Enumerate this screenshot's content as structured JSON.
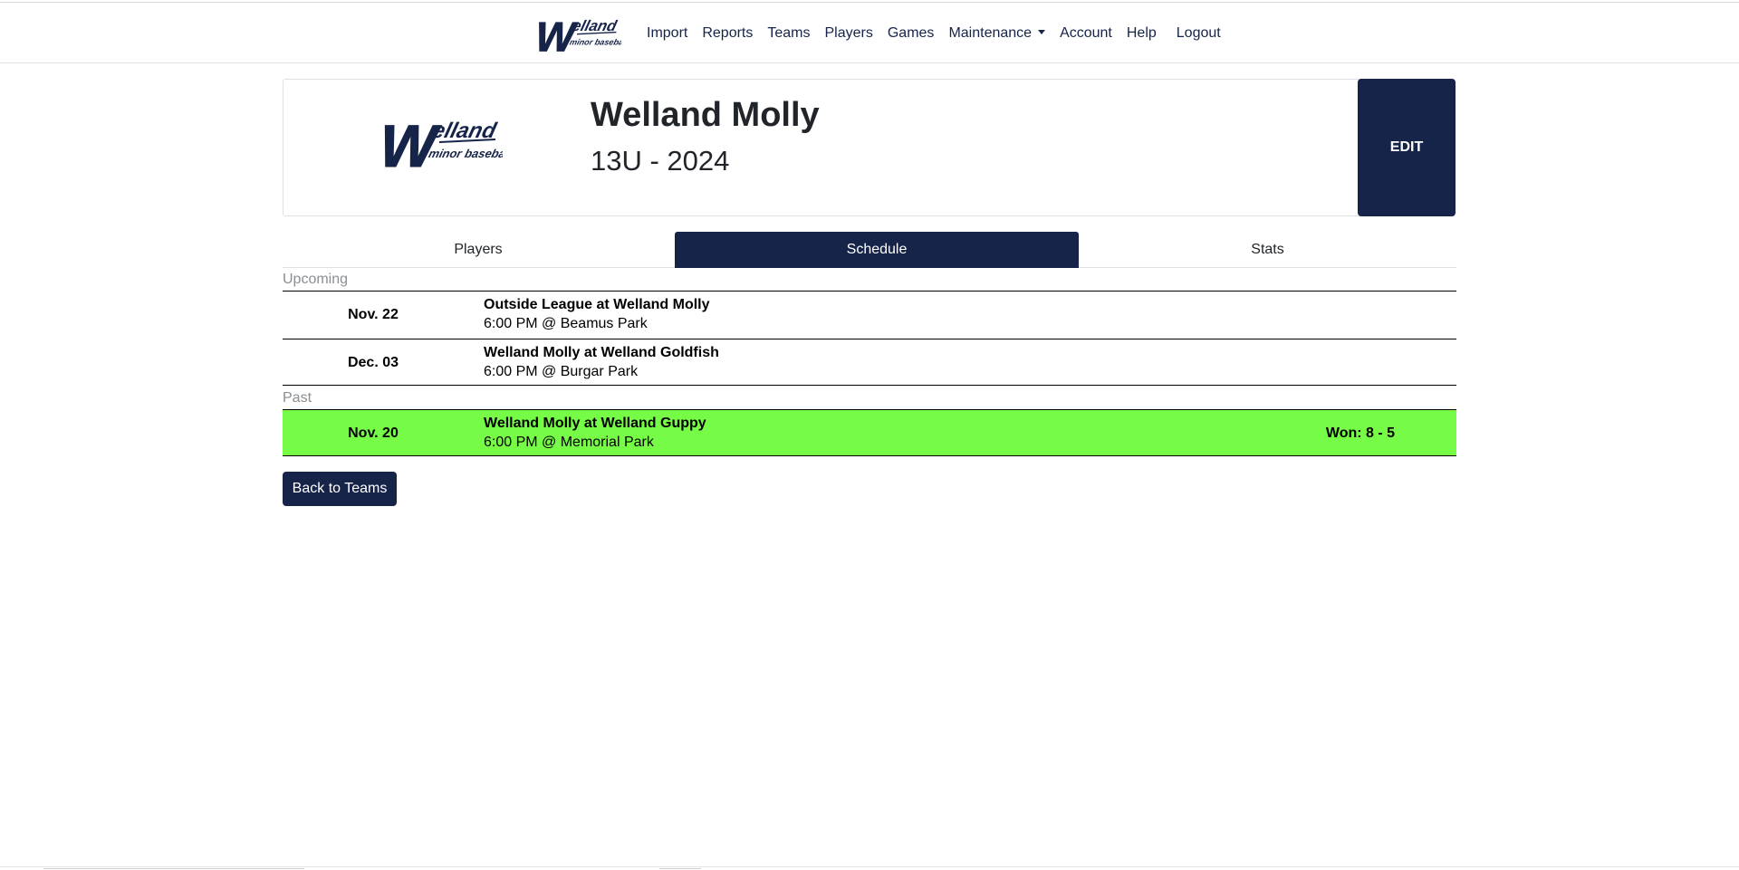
{
  "nav": {
    "logo_icon": "welland-minor-baseball-logo",
    "links": [
      {
        "label": "Import"
      },
      {
        "label": "Reports"
      },
      {
        "label": "Teams"
      },
      {
        "label": "Players"
      },
      {
        "label": "Games"
      },
      {
        "label": "Maintenance"
      },
      {
        "label": "Account"
      },
      {
        "label": "Help"
      },
      {
        "label": "Logout"
      }
    ]
  },
  "logo": {
    "big": "W",
    "word": "elland",
    "sub": "minor baseball"
  },
  "team": {
    "name": "Welland Molly",
    "season": "13U - 2024",
    "edit_label": "EDIT"
  },
  "tabs": [
    {
      "label": "Players",
      "active": false
    },
    {
      "label": "Schedule",
      "active": true
    },
    {
      "label": "Stats",
      "active": false
    }
  ],
  "schedule": {
    "upcoming_label": "Upcoming",
    "past_label": "Past",
    "upcoming": [
      {
        "date": "Nov. 22",
        "matchup": "Outside League at Welland Molly",
        "details": "6:00 PM @ Beamus Park"
      },
      {
        "date": "Dec. 03",
        "matchup": "Welland Molly at Welland Goldfish",
        "details": "6:00 PM @ Burgar Park"
      }
    ],
    "past": [
      {
        "date": "Nov. 20",
        "matchup": "Welland Molly at Welland Guppy",
        "details": "6:00 PM @ Memorial Park",
        "result": "Won: 8 - 5"
      }
    ]
  },
  "back_button_label": "Back to Teams",
  "colors": {
    "brand_navy": "#16244a",
    "win_green": "#76fb46"
  }
}
